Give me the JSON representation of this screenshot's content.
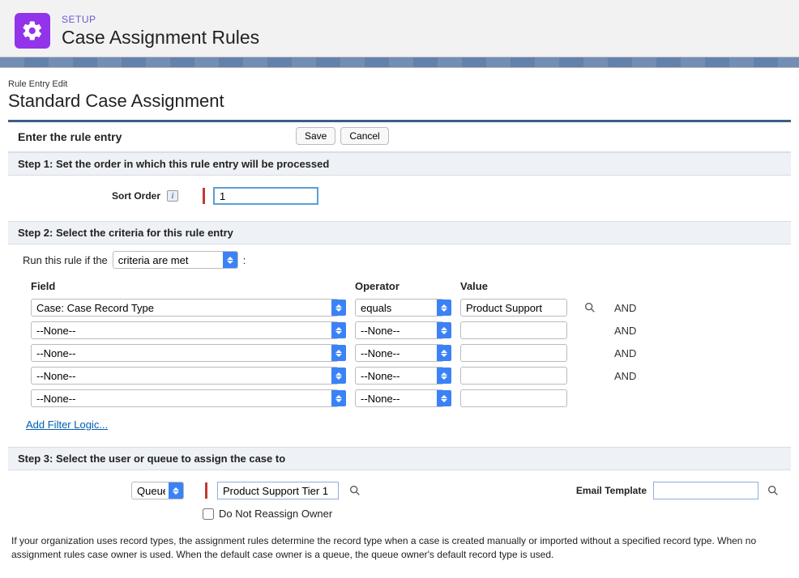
{
  "header": {
    "eyebrow": "SETUP",
    "title": "Case Assignment Rules"
  },
  "breadcrumb": "Rule Entry Edit",
  "page_title": "Standard Case Assignment",
  "enter_section": {
    "title": "Enter the rule entry",
    "save": "Save",
    "cancel": "Cancel"
  },
  "step1": {
    "title": "Step 1: Set the order in which this rule entry will be processed",
    "label": "Sort Order",
    "value": "1"
  },
  "step2": {
    "title": "Step 2: Select the criteria for this rule entry",
    "run_prefix": "Run this rule if the",
    "run_option": "criteria are met",
    "colon": ":",
    "headers": {
      "field": "Field",
      "operator": "Operator",
      "value": "Value"
    },
    "rows": [
      {
        "field": "Case: Case Record Type",
        "operator": "equals",
        "value": "Product Support",
        "and": "AND",
        "lookup": true
      },
      {
        "field": "--None--",
        "operator": "--None--",
        "value": "",
        "and": "AND",
        "lookup": false
      },
      {
        "field": "--None--",
        "operator": "--None--",
        "value": "",
        "and": "AND",
        "lookup": false
      },
      {
        "field": "--None--",
        "operator": "--None--",
        "value": "",
        "and": "AND",
        "lookup": false
      },
      {
        "field": "--None--",
        "operator": "--None--",
        "value": "",
        "and": "",
        "lookup": false
      }
    ],
    "filter_link": "Add Filter Logic..."
  },
  "step3": {
    "title": "Step 3: Select the user or queue to assign the case to",
    "assignee_type": "Queue",
    "assignee_name": "Product Support Tier 1",
    "reassign_label": "Do Not Reassign Owner",
    "email_label": "Email Template",
    "email_value": ""
  },
  "footnote": "If your organization uses record types, the assignment rules determine the record type when a case is created manually or imported without a specified record type. When no assignment rules case owner is used. When the default case owner is a queue, the queue owner's default record type is used."
}
